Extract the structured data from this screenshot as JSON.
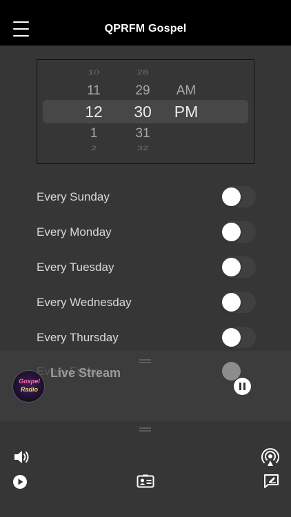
{
  "header": {
    "title": "QPRFM Gospel",
    "menu_icon": "hamburger-menu-icon"
  },
  "time_picker": {
    "hours": [
      "10",
      "11",
      "12",
      "1",
      "2"
    ],
    "minutes": [
      "28",
      "29",
      "30",
      "31",
      "32"
    ],
    "periods": [
      "AM",
      "PM"
    ],
    "selected": {
      "hour": "12",
      "minute": "30",
      "period": "PM"
    }
  },
  "days": [
    {
      "label": "Every Sunday",
      "enabled": false
    },
    {
      "label": "Every Monday",
      "enabled": false
    },
    {
      "label": "Every Tuesday",
      "enabled": false
    },
    {
      "label": "Every Wednesday",
      "enabled": false
    },
    {
      "label": "Every Thursday",
      "enabled": false
    },
    {
      "label": "Every Friday",
      "enabled": false
    }
  ],
  "player": {
    "title": "Live Stream",
    "logo_line1": "Gospel",
    "logo_line2": "Radio",
    "state": "playing",
    "pause_icon": "pause-icon"
  },
  "bottom_bar": {
    "icons": [
      "volume-icon",
      "airplay-icon",
      "play-icon",
      "contact-card-icon",
      "feedback-icon"
    ]
  },
  "colors": {
    "header_bg": "#000000",
    "page_bg": "#363636",
    "player_bg": "#3c3c3c",
    "toggle_off": "#404040"
  }
}
